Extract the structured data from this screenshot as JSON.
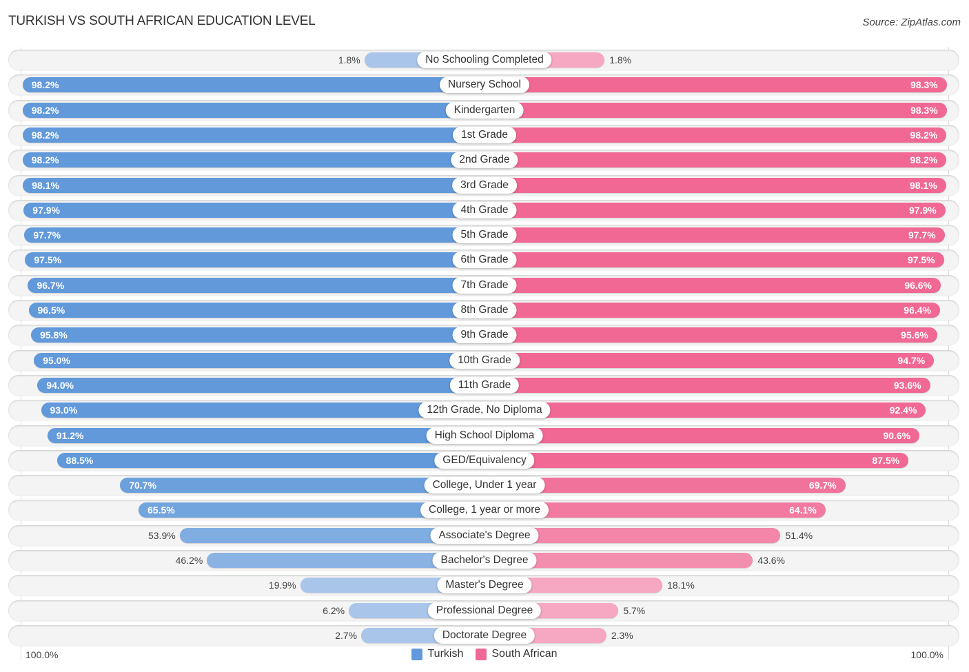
{
  "title": "TURKISH VS SOUTH AFRICAN EDUCATION LEVEL",
  "source": "Source: ZipAtlas.com",
  "colors": {
    "turkish_strong": "#6199da",
    "turkish_light": "#a9c6ea",
    "south_african_strong": "#f06893",
    "south_african_light": "#f6a7c1"
  },
  "axis": {
    "left_label": "100.0%",
    "right_label": "100.0%"
  },
  "legend": [
    {
      "label": "Turkish",
      "color": "#6199da"
    },
    {
      "label": "South African",
      "color": "#f06893"
    }
  ],
  "chart_data": {
    "type": "bar",
    "orientation": "horizontal-diverging",
    "title": "TURKISH VS SOUTH AFRICAN EDUCATION LEVEL",
    "xlabel": "",
    "ylabel": "",
    "xlim": [
      0,
      100
    ],
    "unit": "%",
    "legend_position": "bottom-center",
    "categories": [
      "No Schooling Completed",
      "Nursery School",
      "Kindergarten",
      "1st Grade",
      "2nd Grade",
      "3rd Grade",
      "4th Grade",
      "5th Grade",
      "6th Grade",
      "7th Grade",
      "8th Grade",
      "9th Grade",
      "10th Grade",
      "11th Grade",
      "12th Grade, No Diploma",
      "High School Diploma",
      "GED/Equivalency",
      "College, Under 1 year",
      "College, 1 year or more",
      "Associate's Degree",
      "Bachelor's Degree",
      "Master's Degree",
      "Professional Degree",
      "Doctorate Degree"
    ],
    "series": [
      {
        "name": "Turkish",
        "side": "left",
        "values": [
          1.8,
          98.2,
          98.2,
          98.2,
          98.2,
          98.1,
          97.9,
          97.7,
          97.5,
          96.7,
          96.5,
          95.8,
          95.0,
          94.0,
          93.0,
          91.2,
          88.5,
          70.7,
          65.5,
          53.9,
          46.2,
          19.9,
          6.2,
          2.7
        ],
        "labels": [
          "1.8%",
          "98.2%",
          "98.2%",
          "98.2%",
          "98.2%",
          "98.1%",
          "97.9%",
          "97.7%",
          "97.5%",
          "96.7%",
          "96.5%",
          "95.8%",
          "95.0%",
          "94.0%",
          "93.0%",
          "91.2%",
          "88.5%",
          "70.7%",
          "65.5%",
          "53.9%",
          "46.2%",
          "19.9%",
          "6.2%",
          "2.7%"
        ]
      },
      {
        "name": "South African",
        "side": "right",
        "values": [
          1.8,
          98.3,
          98.3,
          98.2,
          98.2,
          98.1,
          97.9,
          97.7,
          97.5,
          96.6,
          96.4,
          95.6,
          94.7,
          93.6,
          92.4,
          90.6,
          87.5,
          69.7,
          64.1,
          51.4,
          43.6,
          18.1,
          5.7,
          2.3
        ],
        "labels": [
          "1.8%",
          "98.3%",
          "98.3%",
          "98.2%",
          "98.2%",
          "98.1%",
          "97.9%",
          "97.7%",
          "97.5%",
          "96.6%",
          "96.4%",
          "95.6%",
          "94.7%",
          "93.6%",
          "92.4%",
          "90.6%",
          "87.5%",
          "69.7%",
          "64.1%",
          "51.4%",
          "43.6%",
          "18.1%",
          "5.7%",
          "2.3%"
        ]
      }
    ]
  }
}
